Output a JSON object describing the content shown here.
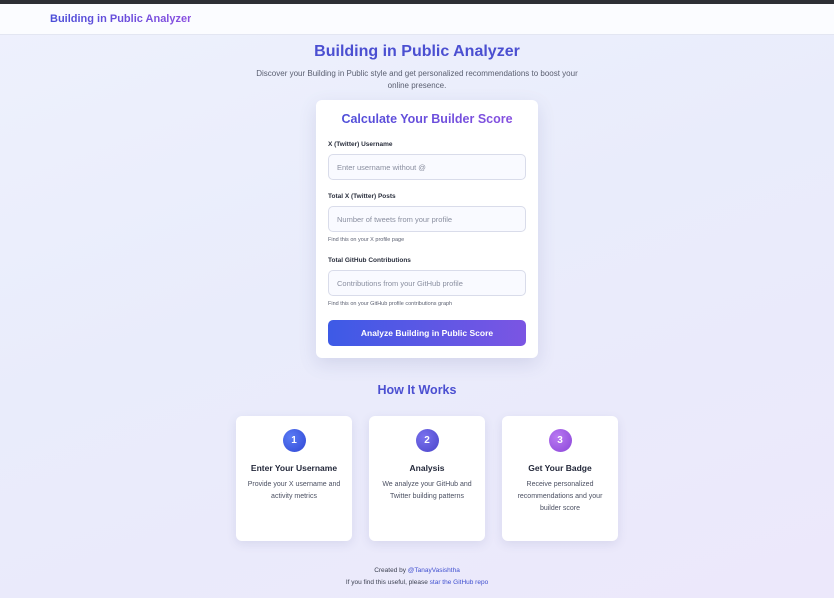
{
  "nav": {
    "brand": "Building in Public Analyzer"
  },
  "hero": {
    "title": "Building in Public Analyzer",
    "subtitle": "Discover your Building in Public style and get personalized recommendations to boost your online presence."
  },
  "form": {
    "title": "Calculate Your Builder Score",
    "username": {
      "label": "X (Twitter) Username",
      "placeholder": "Enter username without @",
      "value": ""
    },
    "posts": {
      "label": "Total X (Twitter) Posts",
      "placeholder": "Number of tweets from your profile",
      "hint": "Find this on your X profile page",
      "value": ""
    },
    "contributions": {
      "label": "Total GitHub Contributions",
      "placeholder": "Contributions from your GitHub profile",
      "hint": "Find this on your GitHub profile contributions graph",
      "value": ""
    },
    "submit_label": "Analyze Building in Public Score"
  },
  "how": {
    "title": "How It Works",
    "steps": [
      {
        "number": "1",
        "title": "Enter Your Username",
        "description": "Provide your X username and activity metrics"
      },
      {
        "number": "2",
        "title": "Analysis",
        "description": "We analyze your GitHub and Twitter building patterns"
      },
      {
        "number": "3",
        "title": "Get Your Badge",
        "description": "Receive personalized recommendations and your builder score"
      }
    ]
  },
  "footer": {
    "created_by": "Created by",
    "author": "@TanayVasishtha",
    "useful_text": "If you find this useful, please",
    "repo_link": "star the GitHub repo"
  },
  "colors": {
    "accent": "#4b4fd1",
    "button_start": "#3d5ae6",
    "button_end": "#7b55e3",
    "step1": "#2f46d4",
    "step2": "#4a44c9",
    "step3": "#8a45d8"
  }
}
